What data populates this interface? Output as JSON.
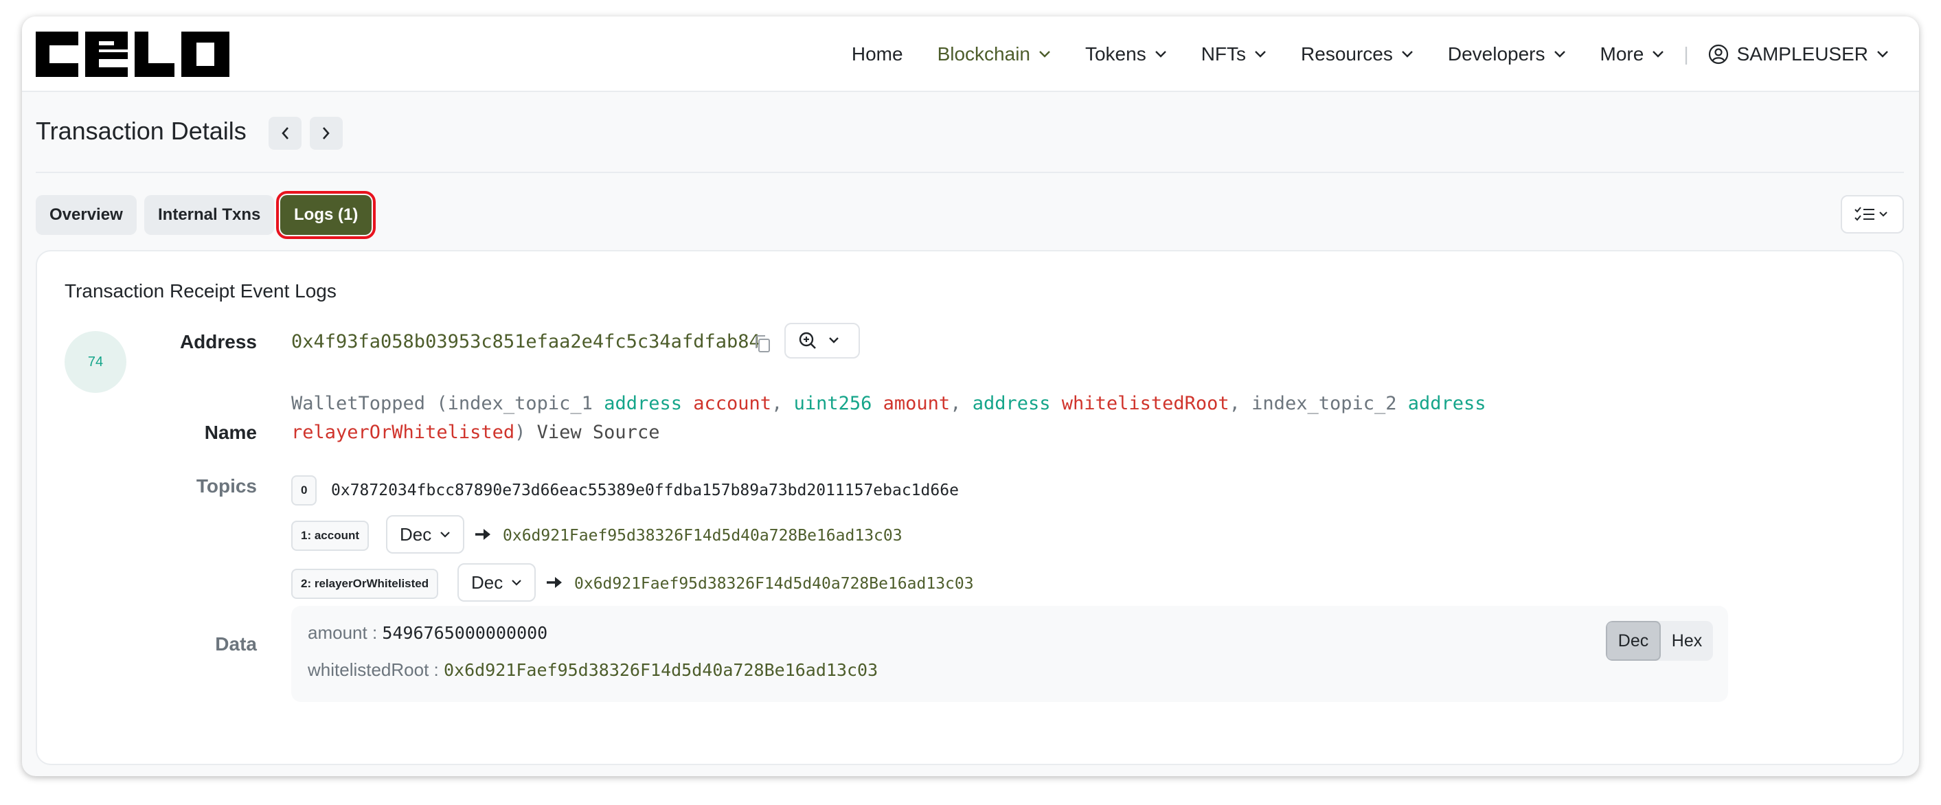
{
  "brand": {
    "name": "CELO"
  },
  "nav": {
    "items": [
      {
        "label": "Home",
        "dropdown": false,
        "active": false
      },
      {
        "label": "Blockchain",
        "dropdown": true,
        "active": true
      },
      {
        "label": "Tokens",
        "dropdown": true,
        "active": false
      },
      {
        "label": "NFTs",
        "dropdown": true,
        "active": false
      },
      {
        "label": "Resources",
        "dropdown": true,
        "active": false
      },
      {
        "label": "Developers",
        "dropdown": true,
        "active": false
      },
      {
        "label": "More",
        "dropdown": true,
        "active": false
      }
    ],
    "separator": "|",
    "user": "SAMPLEUSER"
  },
  "page": {
    "title": "Transaction Details"
  },
  "tabs": [
    {
      "label": "Overview",
      "active": false
    },
    {
      "label": "Internal Txns",
      "active": false
    },
    {
      "label": "Logs (1)",
      "active": true
    }
  ],
  "card": {
    "title": "Transaction Receipt Event Logs",
    "log_index": "74",
    "labels": {
      "address": "Address",
      "name": "Name",
      "topics": "Topics",
      "data": "Data"
    },
    "address": "0x4f93fa058b03953c851efaa2e4fc5c34afdfab84",
    "signature": {
      "event": "WalletTopped",
      "open": "(",
      "p1_index": "index_topic_1",
      "p1_type": "address",
      "p1_name": "account",
      "comma": ",",
      "p2_type": "uint256",
      "p2_name": "amount",
      "p3_type": "address",
      "p3_name": "whitelistedRoot",
      "p4_index": "index_topic_2",
      "p4_type": "address",
      "p4_name": "relayerOrWhitelisted",
      "close": ")",
      "view_source": "View Source"
    },
    "topics": [
      {
        "badge": "0",
        "value": "0x7872034fbcc87890e73d66eac55389e0ffdba157b89a73bd2011157ebac1d66e"
      },
      {
        "badge": "1: account",
        "format": "Dec",
        "value": "0x6d921Faef95d38326F14d5d40a728Be16ad13c03"
      },
      {
        "badge": "2: relayerOrWhitelisted",
        "format": "Dec",
        "value": "0x6d921Faef95d38326F14d5d40a728Be16ad13c03"
      }
    ],
    "data": {
      "rows": [
        {
          "key": "amount :",
          "value": "5496765000000000"
        },
        {
          "key": "whitelistedRoot :",
          "value": "0x6d921Faef95d38326F14d5d40a728Be16ad13c03"
        }
      ],
      "toggle": {
        "dec": "Dec",
        "hex": "Hex",
        "selected": "Dec"
      }
    }
  },
  "colors": {
    "brand_green": "#4d5d2b",
    "active_outline": "#e8131e",
    "type_teal": "#15a58a",
    "name_red": "#d0342c"
  }
}
